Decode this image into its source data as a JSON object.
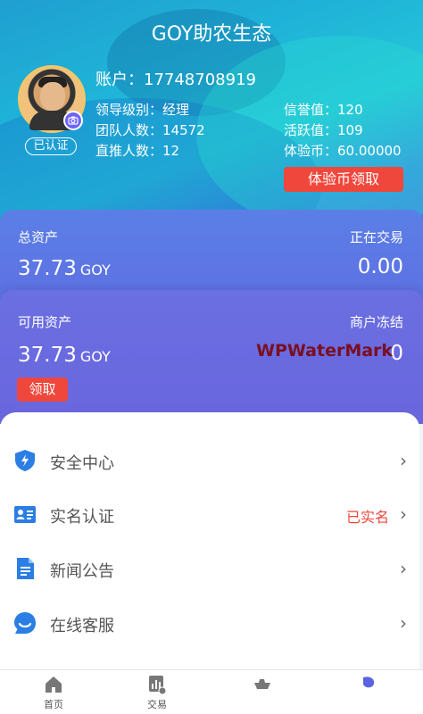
{
  "header": {
    "title": "GOY助农生态"
  },
  "profile": {
    "account": "账户：17748708919",
    "verified_badge": "已认证",
    "leader_level": "领导级别：经理",
    "team_count": "团队人数：14572",
    "direct_count": "直推人数：12",
    "credit_value": "信誉值：120",
    "activity_value": "活跃值：109",
    "exp_coin": "体验币：60.00000",
    "claim_exp_label": "体验币领取"
  },
  "assets": {
    "total_label": "总资产",
    "total_value": "37.73",
    "total_unit": "GOY",
    "trading_label": "正在交易",
    "trading_value": "0.00",
    "available_label": "可用资产",
    "available_value": "37.73",
    "available_unit": "GOY",
    "frozen_label": "商户冻结",
    "frozen_value": "0",
    "claim_label": "领取"
  },
  "watermark": "WPWaterMark",
  "menu": [
    {
      "label": "安全中心",
      "icon": "shield-bolt-icon",
      "status": ""
    },
    {
      "label": "实名认证",
      "icon": "id-card-icon",
      "status": "已实名"
    },
    {
      "label": "新闻公告",
      "icon": "document-icon",
      "status": ""
    },
    {
      "label": "在线客服",
      "icon": "chat-bubble-icon",
      "status": ""
    }
  ],
  "tabbar": [
    {
      "label": "首页",
      "icon": "home-icon"
    },
    {
      "label": "交易",
      "icon": "chart-icon"
    },
    {
      "label": "",
      "icon": "boat-icon"
    },
    {
      "label": "",
      "icon": "profile-icon"
    }
  ],
  "colors": {
    "accent_red": "#f0473c",
    "icon_blue": "#2b7ee3"
  }
}
